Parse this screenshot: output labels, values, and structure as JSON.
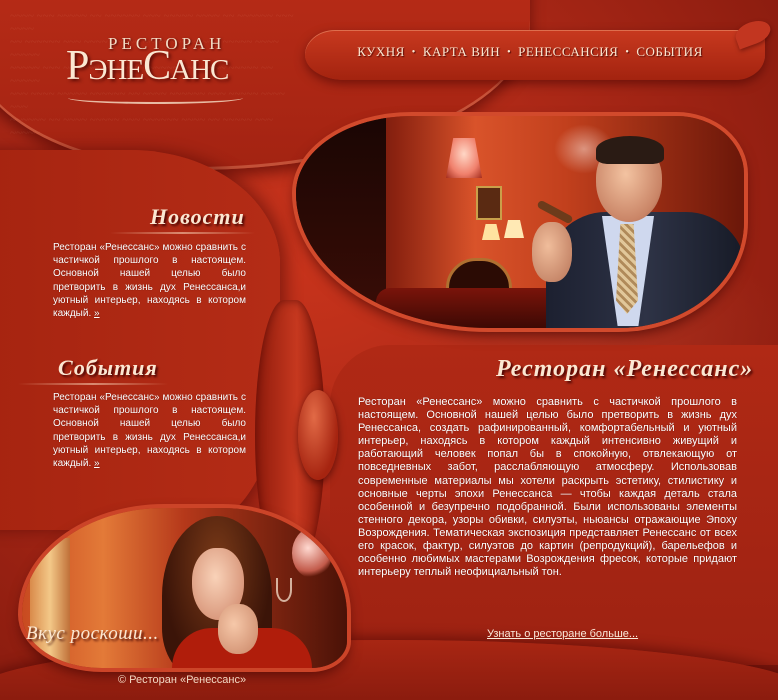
{
  "logo": {
    "top": "РЕСТОРАН",
    "main": "РэнеСанс"
  },
  "nav": {
    "items": [
      "КУХНЯ",
      "КАРТА ВИН",
      "РЕНЕССАНСИЯ",
      "СОБЫТИЯ"
    ],
    "separator": "•"
  },
  "news": {
    "title": "Новости",
    "text": "Ресторан «Ренессанс» можно сравнить с частичкой прошлого в настоящем. Основной нашей целью было претворить в жизнь дух Ренессанса,и уютный интерьер, находясь в котором каждый.",
    "more": "»"
  },
  "events": {
    "title": "События",
    "text": "Ресторан «Ренессанс» можно сравнить с частичкой прошлого в настоящем. Основной нашей целью было претворить в жизнь дух Ренессанса,и уютный интерьер, находясь в котором каждый.",
    "more": "»"
  },
  "main": {
    "title": "Ресторан «Ренессанс»",
    "text": "Ресторан «Ренессанс» можно сравнить с частичкой прошлого в настоящем. Основной нашей целью было претворить в жизнь дух Ренессанса, создать рафинированный, комфортабельный и уютный интерьер, находясь в котором каждый интенсивно живущий и работающий человек попал бы в спокойную, отвлекающую от повседневных забот, расслабляющую атмосферу. Использовав современные материалы мы хотели раскрыть эстетику, стилистику и основные черты эпохи Ренессанса — чтобы каждая деталь стала особенной и безупречно подобранной. Были использованы элементы стенного декора, узоры обивки, силуэты, ньюансы отражающие Эпоху Возрождения. Тематическая экспозиция представляет Ренессанс от всех его красок, фактур, силуэтов до картин (репродукций), барельефов и особенно любимых мастерами Возрождения фресок, которые придают интерьеру теплый неофициальный тон.",
    "link": "Узнать о ресторане больше..."
  },
  "promo": {
    "caption": "Вкус роскоши..."
  },
  "footer": {
    "copyright": "© Ресторан «Ренессанс»"
  },
  "colors": {
    "background": "#9c1f10",
    "text": "#ffffff",
    "heading": "#fbe7d2"
  }
}
